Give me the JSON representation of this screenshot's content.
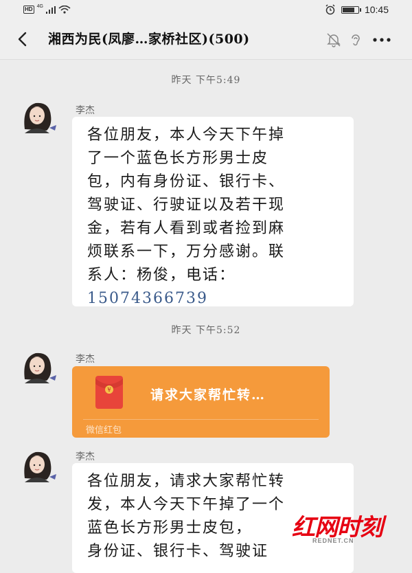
{
  "status_bar": {
    "hd": "HD",
    "network": "4G",
    "time": "10:45",
    "battery_level": 0.85
  },
  "header": {
    "title": "湘西为民(凤廖…家桥社区)(500)",
    "icons": [
      "back-arrow-icon",
      "mute-bell-icon",
      "ear-icon",
      "more-icon"
    ]
  },
  "messages": [
    {
      "time": "昨天  下午5:49",
      "sender": "李杰",
      "lines": [
        "各位朋友，本人今天下午掉",
        "了一个蓝色长方形男士皮",
        "包，内有身份证、银行卡、",
        "驾驶证、行驶证以及若干现",
        "金，若有人看到或者捡到麻",
        "烦联系一下，万分感谢。联",
        "系人：杨俊，电话："
      ],
      "phone": "15074366739"
    },
    {
      "time": "昨天  下午5:52",
      "sender": "李杰",
      "red_packet": {
        "text": "请求大家帮忙转…",
        "footer": "微信红包"
      }
    },
    {
      "sender": "李杰",
      "lines": [
        "各位朋友，请求大家帮忙转",
        "发，本人今天下午掉了一个",
        "蓝色长方形男士皮包，",
        "身份证、银行卡、驾驶证"
      ]
    }
  ],
  "watermark": {
    "main": "红网时刻",
    "sub": "REDNET.CN"
  },
  "colors": {
    "red_packet": "#f59a3b",
    "watermark": "#e60012",
    "phone_link": "#3a5a8a"
  }
}
